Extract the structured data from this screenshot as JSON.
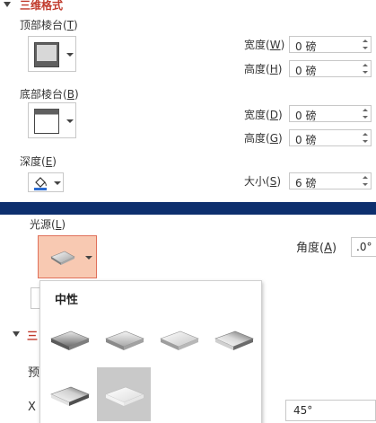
{
  "format3d": {
    "section_title": "三维格式",
    "top_bevel_label": "顶部棱台",
    "top_bevel_key": "T",
    "bottom_bevel_label": "底部棱台",
    "bottom_bevel_key": "B",
    "depth_label": "深度",
    "depth_key": "E",
    "top_width_label": "宽度",
    "top_width_key": "W",
    "top_width_value": "0 磅",
    "top_height_label": "高度",
    "top_height_key": "H",
    "top_height_value": "0 磅",
    "bottom_width_label": "宽度",
    "bottom_width_key": "D",
    "bottom_width_value": "0 磅",
    "bottom_height_label": "高度",
    "bottom_height_key": "G",
    "bottom_height_value": "0 磅",
    "size_label": "大小",
    "size_key": "S",
    "size_value": "6 磅",
    "depth_color": "#2a6bd1"
  },
  "lighting": {
    "label": "光源",
    "key": "L",
    "angle_label": "角度",
    "angle_key": "A",
    "angle_value": ".0°",
    "popup_header": "中性",
    "accent_border": "#e0705a",
    "accent_fill": "#f8c9b2"
  },
  "behind": {
    "section_fragment": "三",
    "label_fragment": "预",
    "x_fragment": "X",
    "value_45": "45°"
  }
}
